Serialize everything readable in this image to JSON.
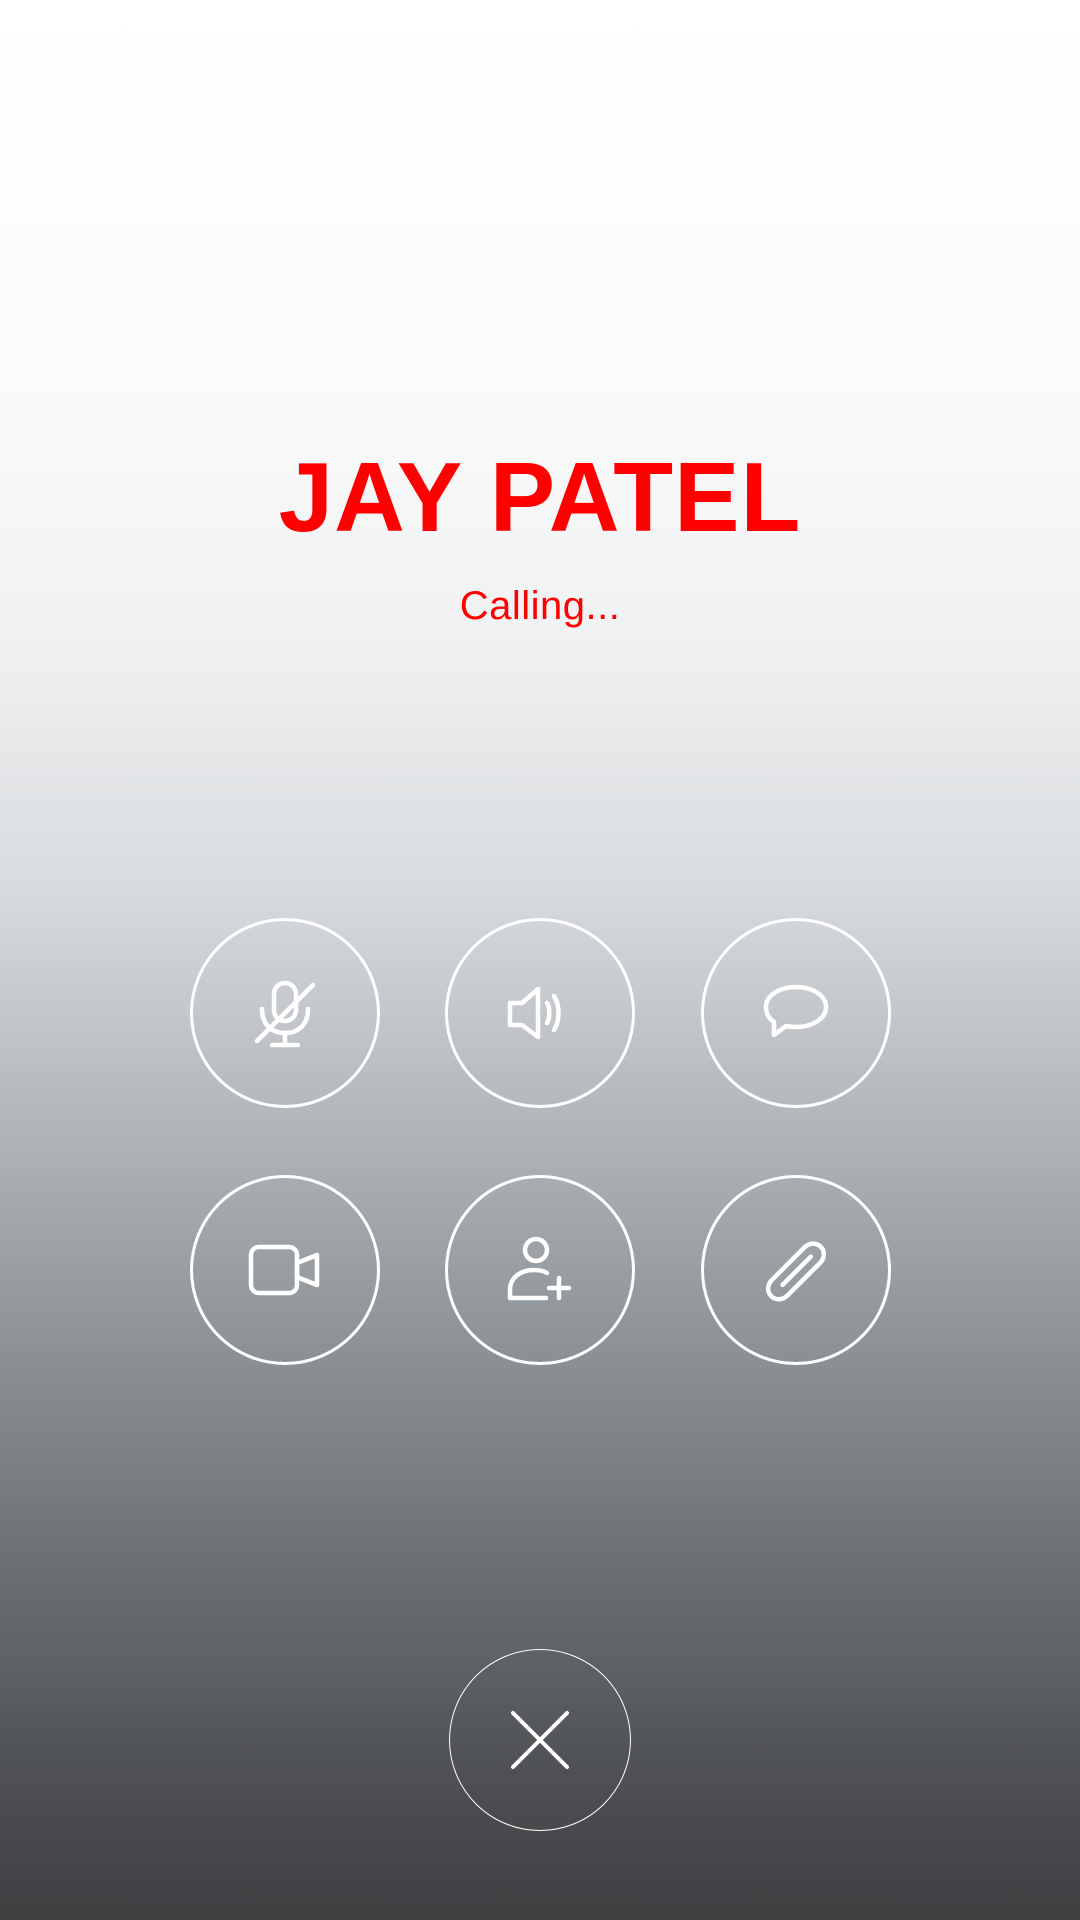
{
  "caller": {
    "name": "JAY PATEL",
    "status": "Calling..."
  },
  "colors": {
    "accent": "#ff0000",
    "icon": "#ffffff"
  },
  "controls": [
    {
      "icon": "microphone-muted-icon",
      "action": "mute"
    },
    {
      "icon": "speaker-icon",
      "action": "speaker"
    },
    {
      "icon": "chat-bubble-icon",
      "action": "message"
    },
    {
      "icon": "video-camera-icon",
      "action": "video"
    },
    {
      "icon": "add-person-icon",
      "action": "add-participant"
    },
    {
      "icon": "paperclip-icon",
      "action": "attach"
    }
  ],
  "end_call": {
    "icon": "close-icon"
  }
}
